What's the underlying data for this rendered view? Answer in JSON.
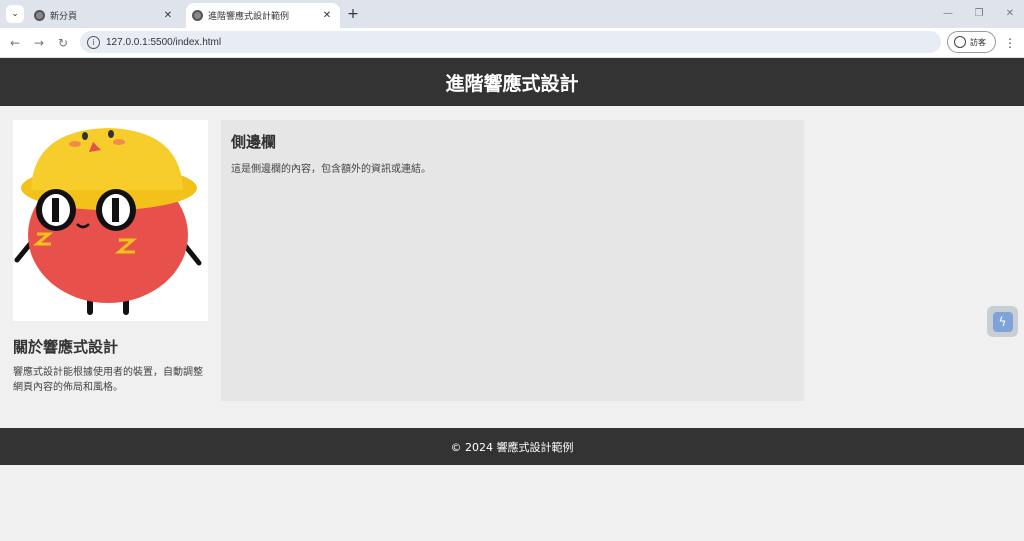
{
  "browser": {
    "tabs": [
      {
        "title": "新分頁"
      },
      {
        "title": "進階響應式設計範例"
      }
    ],
    "new_tab_label": "+",
    "url": "127.0.0.1:5500/index.html",
    "guest_label": "訪客",
    "menu_glyph": "⋮"
  },
  "page": {
    "header_title": "進階響應式設計",
    "about": {
      "heading": "關於響應式設計",
      "text": "響應式設計能根據使用者的裝置，自動調整網頁內容的佈局和風格。"
    },
    "sidebar": {
      "heading": "側邊欄",
      "text": "這是側邊欄的內容，包含額外的資訊或連結。"
    },
    "footer": "© 2024 響應式設計範例"
  },
  "colors": {
    "header_bg": "#333333",
    "footer_bg": "#333333",
    "page_bg": "#f0f0f0",
    "sidebar_bg": "#e6e6e6"
  }
}
